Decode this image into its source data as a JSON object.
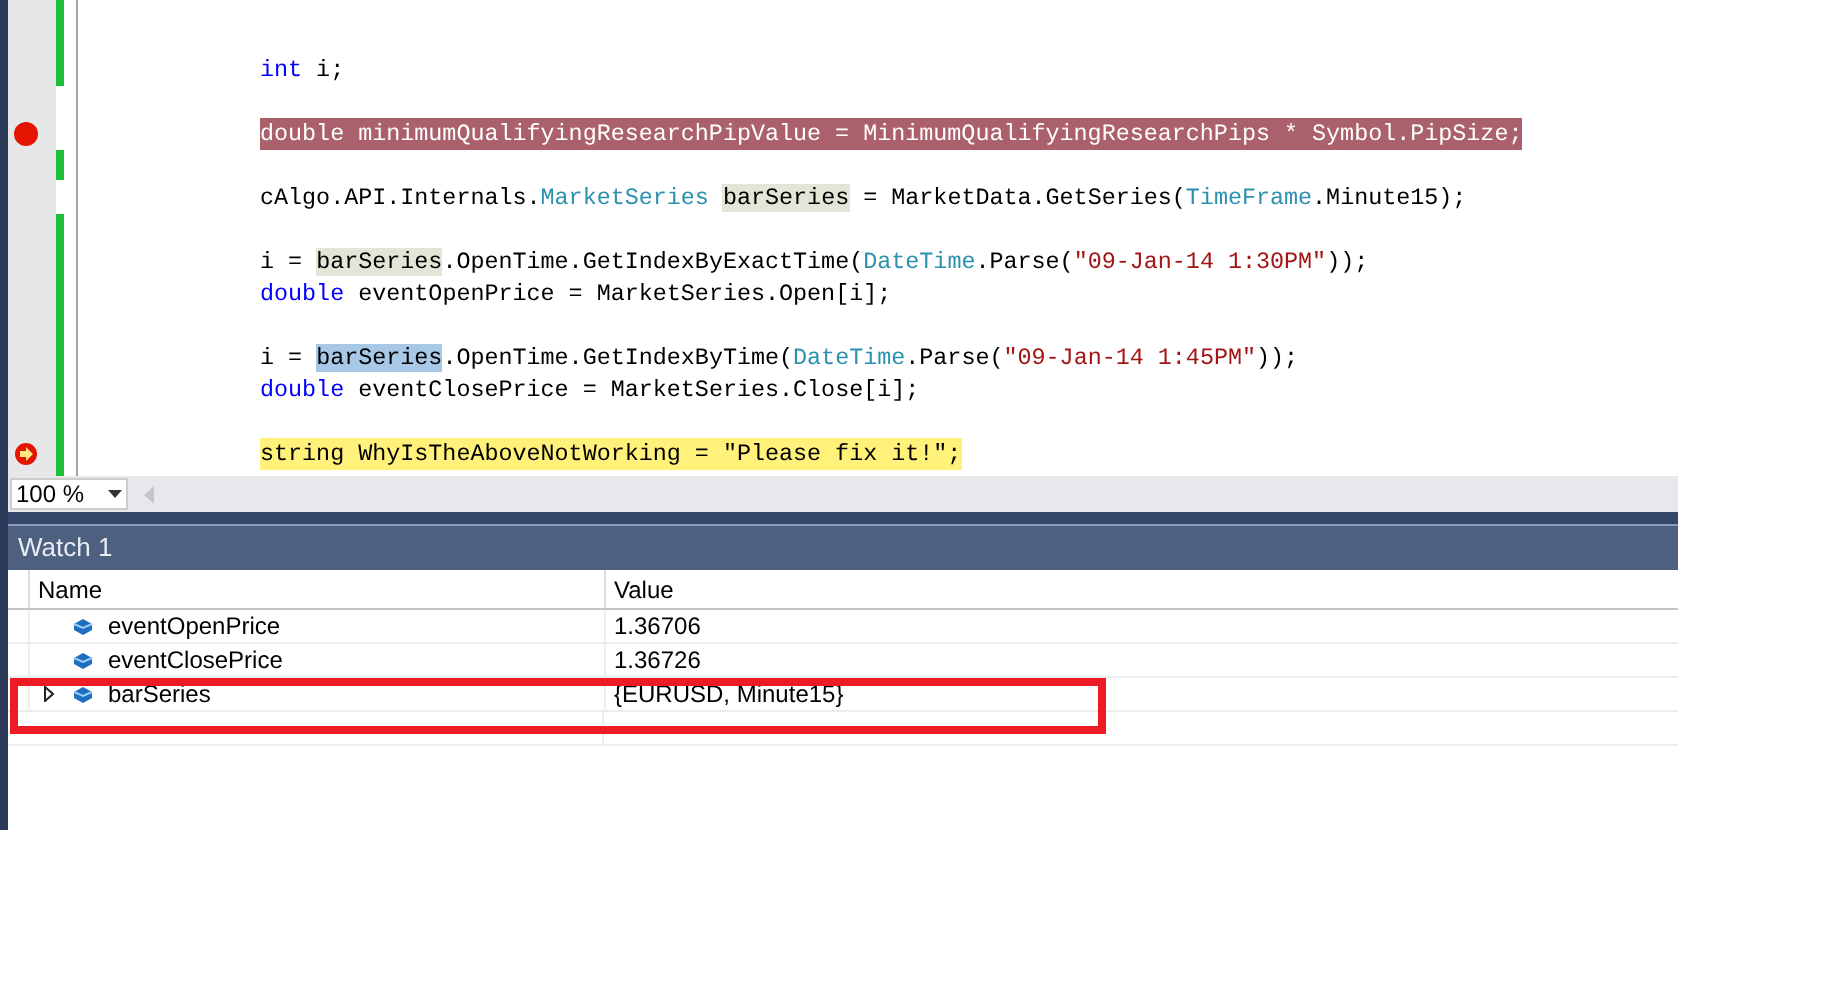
{
  "editor": {
    "blocks": [
      [
        {
          "kind": "normal",
          "tokens": [
            {
              "text": "int",
              "kind": "keyword"
            },
            {
              "text": " i;",
              "kind": "plain"
            }
          ]
        }
      ],
      [
        {
          "kind": "breakpoint",
          "text": "double minimumQualifyingResearchPipValue = MinimumQualifyingResearchPips * Symbol.PipSize;"
        }
      ],
      [
        {
          "kind": "normal",
          "tokens": [
            {
              "text": "cAlgo.API.Internals.",
              "kind": "plain"
            },
            {
              "text": "MarketSeries ",
              "kind": "type"
            },
            {
              "text": "barSeries",
              "kind": "plain",
              "reference": true,
              "selected": false
            },
            {
              "text": " = MarketData.GetSeries(",
              "kind": "plain"
            },
            {
              "text": "TimeFrame",
              "kind": "type"
            },
            {
              "text": ".Minute15);",
              "kind": "plain"
            }
          ]
        }
      ],
      [
        {
          "kind": "normal",
          "tokens": [
            {
              "text": "i = ",
              "kind": "plain"
            },
            {
              "text": "barSeries",
              "kind": "plain",
              "reference": true,
              "selected": false
            },
            {
              "text": ".OpenTime.GetIndexByExactTime(",
              "kind": "plain"
            },
            {
              "text": "DateTime",
              "kind": "type"
            },
            {
              "text": ".Parse(",
              "kind": "plain"
            },
            {
              "text": "\"09-Jan-14 1:30PM\"",
              "kind": "string"
            },
            {
              "text": "));",
              "kind": "plain"
            }
          ]
        },
        {
          "kind": "normal",
          "tokens": [
            {
              "text": "double",
              "kind": "keyword"
            },
            {
              "text": " eventOpenPrice = MarketSeries.Open[i];",
              "kind": "plain"
            }
          ]
        }
      ],
      [
        {
          "kind": "normal",
          "tokens": [
            {
              "text": "i = ",
              "kind": "plain"
            },
            {
              "text": "barSeries",
              "kind": "plain",
              "reference": true,
              "selected": true
            },
            {
              "text": ".OpenTime.GetIndexByTime(",
              "kind": "plain"
            },
            {
              "text": "DateTime",
              "kind": "type"
            },
            {
              "text": ".Parse(",
              "kind": "plain"
            },
            {
              "text": "\"09-Jan-14 1:45PM\"",
              "kind": "string"
            },
            {
              "text": "));",
              "kind": "plain"
            }
          ]
        },
        {
          "kind": "normal",
          "tokens": [
            {
              "text": "double",
              "kind": "keyword"
            },
            {
              "text": " eventClosePrice = MarketSeries.Close[i];",
              "kind": "plain"
            }
          ]
        }
      ],
      [
        {
          "kind": "current",
          "text": "string WhyIsTheAboveNotWorking = \"Please fix it!\";"
        }
      ]
    ],
    "zoom": "100 %"
  },
  "watch": {
    "title": "Watch 1",
    "columns": [
      "Name",
      "Value"
    ],
    "rows": [
      {
        "name": "eventOpenPrice",
        "value": "1.36706",
        "expandable": false,
        "annotated": false
      },
      {
        "name": "eventClosePrice",
        "value": "1.36726",
        "expandable": false,
        "annotated": false
      },
      {
        "name": "barSeries",
        "value": "{EURUSD, Minute15}",
        "expandable": true,
        "annotated": true
      }
    ]
  }
}
